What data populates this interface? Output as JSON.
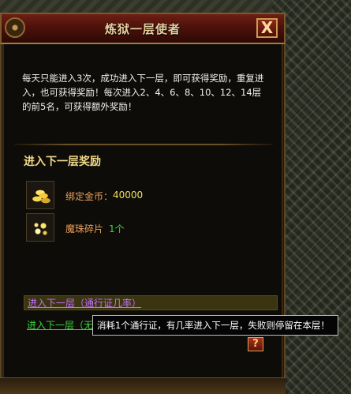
{
  "window": {
    "title": "炼狱一层使者",
    "close_label": "X"
  },
  "description": "每天只能进入3次，成功进入下一层，即可获得奖励，重复进入，也可获得奖励！每次进入2、4、6、8、10、12、14层的前5名，可获得额外奖励！",
  "rewards_section": {
    "title": "进入下一层奖励",
    "items": [
      {
        "icon": "gold-coins-icon",
        "label": "绑定金币：",
        "value": "40000",
        "value_color": "#f2e060"
      },
      {
        "icon": "magic-orb-shard-icon",
        "label": "魔珠碎片",
        "value": "1个",
        "value_color": "#3ed23e"
      }
    ]
  },
  "links": {
    "option1": "进入下一层（通行证几率）",
    "option2": "进入下一层（无"
  },
  "tooltip": "消耗1个通行证，有几率进入下一层，失败则停留在本层！",
  "help_label": "?",
  "colors": {
    "title_text": "#e8d0a0",
    "section_title": "#f2d888",
    "link_purple": "#c070ff",
    "link_green": "#3ed23e"
  }
}
